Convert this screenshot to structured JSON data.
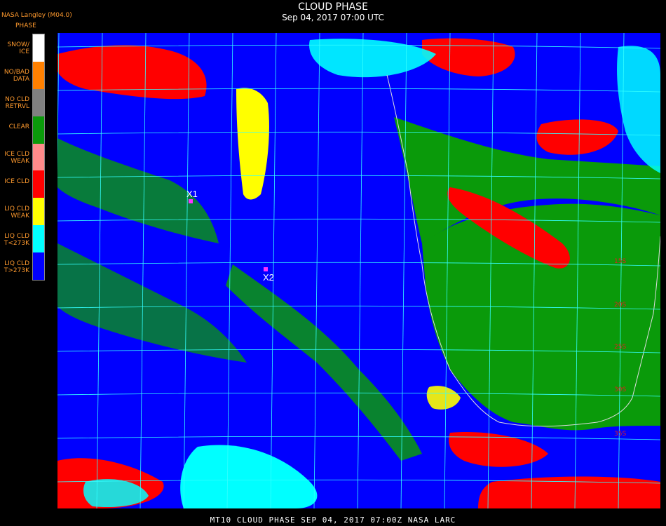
{
  "header": {
    "title": "CLOUD PHASE",
    "subtitle": "Sep 04, 2017 07:00 UTC",
    "brand": "NASA Langley (M04.0)",
    "legend_title": "PHASE"
  },
  "legend": [
    {
      "label": "SNOW/\nICE",
      "color": "#ffffff"
    },
    {
      "label": "NO/BAD\nDATA",
      "color": "#ff8000"
    },
    {
      "label": "NO CLD\nRETRVL",
      "color": "#808080"
    },
    {
      "label": "CLEAR",
      "color": "#0a9a0a"
    },
    {
      "label": "ICE CLD\nWEAK",
      "color": "#ff8a8a"
    },
    {
      "label": "ICE CLD",
      "color": "#ff0000"
    },
    {
      "label": "LIQ CLD\nWEAK",
      "color": "#ffff00"
    },
    {
      "label": "LIQ CLD\nT<273K",
      "color": "#00ffff"
    },
    {
      "label": "LIQ CLD\nT>273K",
      "color": "#0000ff"
    }
  ],
  "markers": [
    {
      "label": "X1"
    },
    {
      "label": "X2"
    }
  ],
  "lat_labels": [
    "15S",
    "20S",
    "25S",
    "30S",
    "35S"
  ],
  "footer": "MT10  CLOUD PHASE   SEP 04, 2017 07:00Z   NASA LARC",
  "colors": {
    "grid": "#33ffff",
    "coast": "#dddddd",
    "marker": "#ff33ff"
  }
}
